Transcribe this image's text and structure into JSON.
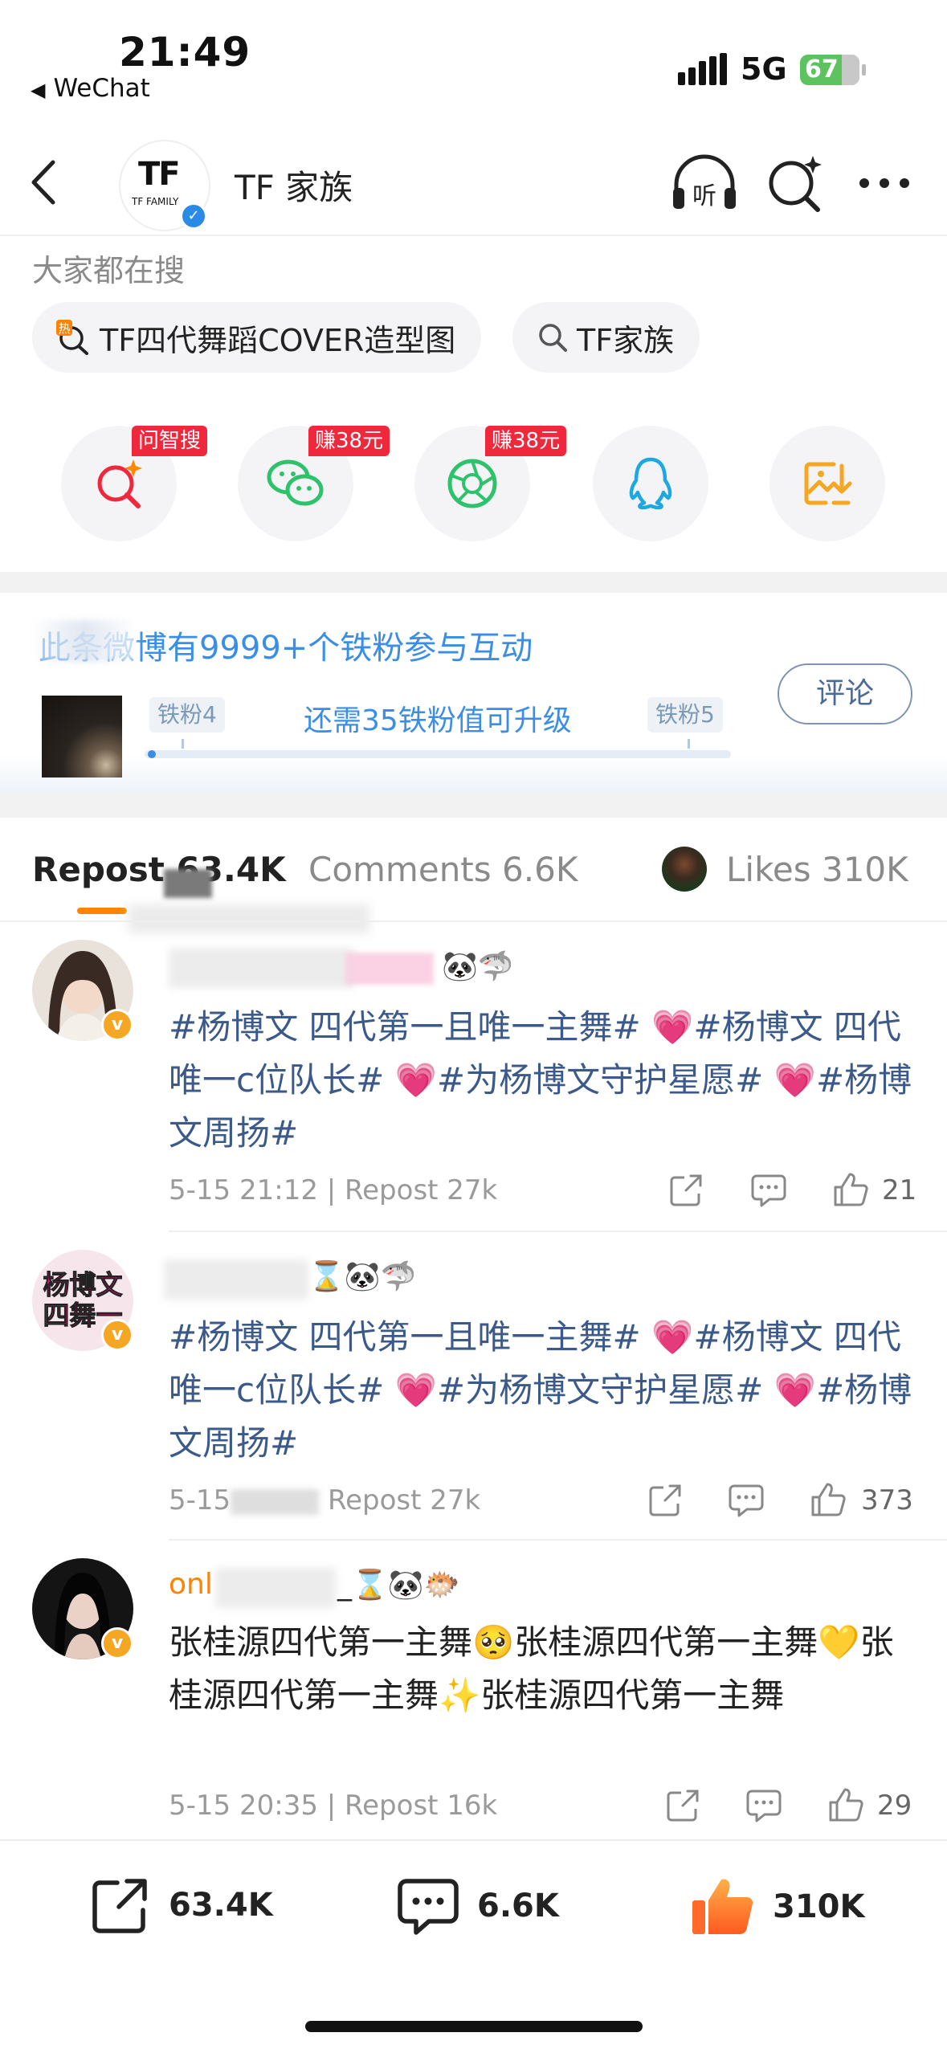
{
  "status_bar": {
    "time": "21:49",
    "back_app": "WeChat",
    "network": "5G",
    "battery": "67"
  },
  "nav": {
    "title": "TF 家族",
    "avatar_logo": "TF",
    "avatar_sub": "TF FAMILY",
    "listen_icon": "headphones-listen-icon",
    "search_icon": "search-sparkle-icon",
    "more_icon": "more-dots-icon"
  },
  "hot_search": {
    "label": "大家都在搜",
    "chips": [
      {
        "label": "TF四代舞蹈COVER造型图",
        "icon": "hot-search-icon"
      },
      {
        "label": "TF家族",
        "icon": "search-icon"
      }
    ]
  },
  "share": {
    "items": [
      {
        "name": "ask-zhisou",
        "icon": "sparkle-search-icon",
        "badge": "问智搜",
        "color": "#f0283c"
      },
      {
        "name": "wechat",
        "icon": "wechat-icon",
        "badge": "赚38元",
        "color": "#2dc26b"
      },
      {
        "name": "moments",
        "icon": "moments-aperture-icon",
        "badge": "赚38元",
        "color": "#2dc26b"
      },
      {
        "name": "qq",
        "icon": "qq-penguin-icon",
        "badge": "",
        "color": "#1fa8e0"
      },
      {
        "name": "save-image",
        "icon": "save-image-icon",
        "badge": "",
        "color": "#f5a623"
      }
    ]
  },
  "fans": {
    "title": "此条微博有9999+个铁粉参与互动",
    "level_current": "铁粉4",
    "level_next": "铁粉5",
    "need_text": "还需35铁粉值可升级",
    "comment_button": "评论"
  },
  "tabs": {
    "repost_label": "Repost",
    "repost_count": "63.4K",
    "comments_label": "Comments",
    "comments_count": "6.6K",
    "likes_label": "Likes",
    "likes_count": "310K"
  },
  "reposts": [
    {
      "emojis": "🐼🦈",
      "text": "#杨博文 四代第一且唯一主舞# 💗#杨博文 四代唯一c位队长# 💗#为杨博文守护星愿# 💗#杨博文周扬#",
      "time": "5-15 21:12",
      "repost": "Repost 27k",
      "likes": "21"
    },
    {
      "emojis": "⌛🐼🦈",
      "avatar_text": "杨博文\n四舞一",
      "text": "#杨博文 四代第一且唯一主舞# 💗#杨博文 四代唯一c位队长# 💗#为杨博文守护星愿# 💗#杨博文周扬#",
      "time": "5-15",
      "repost": "Repost 27k",
      "likes": "373"
    },
    {
      "name_prefix": "onl",
      "emojis": "_⌛🐼🐡",
      "text": "张桂源四代第一主舞🥺张桂源四代第一主舞💛张桂源四代第一主舞✨张桂源四代第一主舞",
      "time": "5-15 20:35",
      "repost": "Repost 16k",
      "likes": "29"
    }
  ],
  "bottom_bar": {
    "repost": "63.4K",
    "comments": "6.6K",
    "likes": "310K",
    "like_color": "#ff8200"
  }
}
